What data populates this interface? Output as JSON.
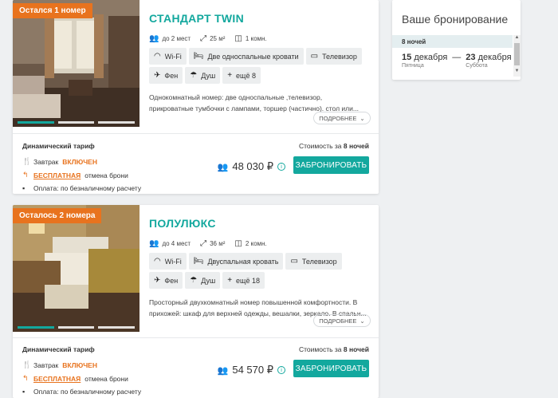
{
  "rooms": [
    {
      "badge": "Остался 1 номер",
      "title": "СТАНДАРТ TWIN",
      "specs": {
        "guests": "до 2 мест",
        "area": "25 м²",
        "rooms": "1 комн."
      },
      "amenities_row1": [
        "Wi-Fi",
        "Две односпальные кровати",
        "Телевизор"
      ],
      "amenities_row2": [
        "Фен",
        "Душ",
        "ещё 8"
      ],
      "description": "Однокомнатный номер: две односпальные ,телевизор, прикроватные тумбочки с лампами, торшер (частично). стол или...",
      "more_label": "ПОДРОБНЕЕ",
      "tariff": {
        "name": "Динамический тариф",
        "breakfast_prefix": "Завтрак",
        "breakfast_status": "ВКЛЮЧЕН",
        "cancel_free": "БЕСПЛАТНАЯ",
        "cancel_suffix": "отмена брони",
        "payment": "Оплата: по безналичному расчету",
        "stay_prefix": "Стоимость за",
        "stay_nights": "8 ночей",
        "price": "48 030 ₽",
        "book_label": "ЗАБРОНИРОВАТЬ"
      }
    },
    {
      "badge": "Осталось 2 номера",
      "title": "ПОЛУЛЮКС",
      "specs": {
        "guests": "до 4 мест",
        "area": "36 м²",
        "rooms": "2 комн."
      },
      "amenities_row1": [
        "Wi-Fi",
        "Двуспальная кровать",
        "Телевизор"
      ],
      "amenities_row2": [
        "Фен",
        "Душ",
        "ещё 18"
      ],
      "description": "Просторный двухкомнатный номер повышенной комфортности. В прихожей: шкаф для верхней одежды, вешалки, зеркало. В спальн...",
      "more_label": "ПОДРОБНЕЕ",
      "tariff": {
        "name": "Динамический тариф",
        "breakfast_prefix": "Завтрак",
        "breakfast_status": "ВКЛЮЧЕН",
        "cancel_free": "БЕСПЛАТНАЯ",
        "cancel_suffix": "отмена брони",
        "payment": "Оплата: по безналичному расчету",
        "stay_prefix": "Стоимость за",
        "stay_nights": "8 ночей",
        "price": "54 570 ₽",
        "book_label": "ЗАБРОНИРОВАТЬ"
      }
    }
  ],
  "booking": {
    "title": "Ваше бронирование",
    "nights": "8 ночей",
    "checkin_day": "15",
    "checkin_month": "декабря",
    "checkin_weekday": "Пятница",
    "checkout_day": "23",
    "checkout_month": "декабря",
    "checkout_weekday": "Суббота"
  },
  "colors": {
    "accent": "#13a89e",
    "badge": "#e8731e",
    "highlight": "#e8731e"
  },
  "icons": {
    "guests": "guests-icon",
    "area": "area-icon",
    "rooms": "rooms-icon",
    "wifi": "wifi-icon",
    "bed": "bed-icon",
    "tv": "tv-icon",
    "hairdryer": "hairdryer-icon",
    "shower": "shower-icon",
    "plus": "plus-icon"
  }
}
